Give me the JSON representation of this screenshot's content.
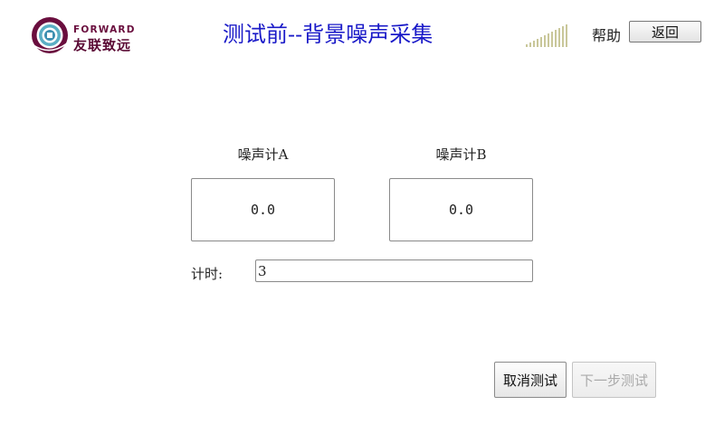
{
  "header": {
    "logo_en": "FORWARD",
    "logo_cn": "友联致远",
    "title": "测试前--背景噪声采集",
    "help_label": "帮助",
    "back_label": "返回",
    "signal_icon": "signal-strength-icon"
  },
  "meters": {
    "a": {
      "label": "噪声计A",
      "value": "0.0"
    },
    "b": {
      "label": "噪声计B",
      "value": "0.0"
    }
  },
  "timer": {
    "label": "计时:",
    "value": "3"
  },
  "actions": {
    "cancel_label": "取消测试",
    "next_label": "下一步测试",
    "next_enabled": false
  },
  "colors": {
    "title": "#1a1ac8",
    "brand": "#6a0e3e",
    "signal": "#c8c8a0"
  }
}
